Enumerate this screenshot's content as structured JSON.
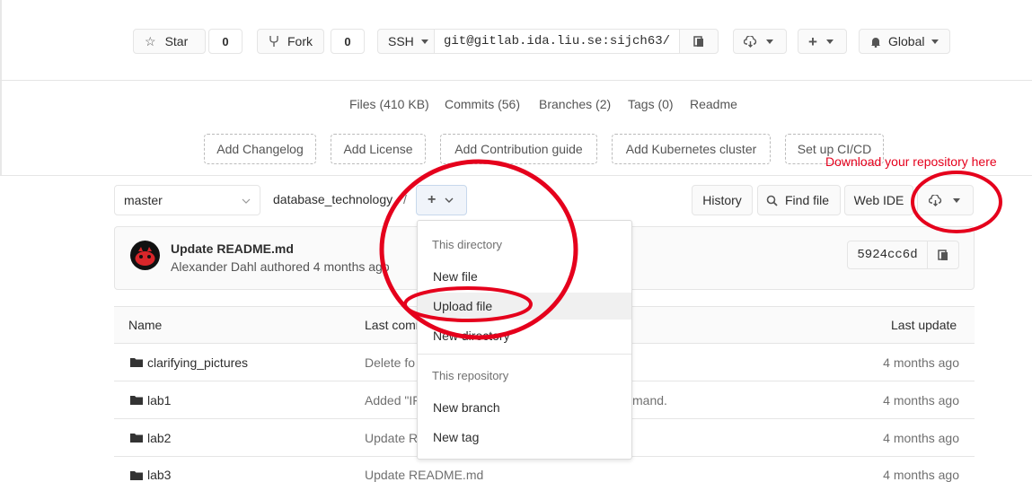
{
  "top_bar": {
    "star_label": "Star",
    "star_count": "0",
    "fork_label": "Fork",
    "fork_count": "0",
    "clone_protocol": "SSH",
    "clone_url": "git@gitlab.ida.liu.se:sijch63/",
    "notification_label": "Global"
  },
  "stats": {
    "files": "Files (410 KB)",
    "commits": "Commits (56)",
    "branches": "Branches (2)",
    "tags": "Tags (0)",
    "readme": "Readme"
  },
  "quick_actions": [
    "Add Changelog",
    "Add License",
    "Add Contribution guide",
    "Add Kubernetes cluster",
    "Set up CI/CD"
  ],
  "annotation": "Download your repository here",
  "toolbar": {
    "branch": "master",
    "path": "database_technology",
    "path_sep": "/",
    "history": "History",
    "find_file": "Find file",
    "web_ide": "Web IDE"
  },
  "last_commit": {
    "title": "Update README.md",
    "meta": "Alexander Dahl authored 4 months ago",
    "sha": "5924cc6d"
  },
  "table": {
    "headers": {
      "name": "Name",
      "last_commit": "Last commit",
      "last_update": "Last update"
    },
    "rows": [
      {
        "name": "clarifying_pictures",
        "message": "Delete fo",
        "date": "4 months ago"
      },
      {
        "name": "lab1",
        "message": "Added \"IF",
        "message_tail": "mand.",
        "date": "4 months ago"
      },
      {
        "name": "lab2",
        "message": "Update R",
        "date": "4 months ago"
      },
      {
        "name": "lab3",
        "message": "Update README.md",
        "date": "4 months ago"
      }
    ]
  },
  "dropdown": {
    "section1": "This directory",
    "items1": [
      "New file",
      "Upload file",
      "New directory"
    ],
    "section2": "This repository",
    "items2": [
      "New branch",
      "New tag"
    ]
  },
  "colors": {
    "annotation_red": "#e5001c",
    "border": "#e5e5e5",
    "hover": "#f0f0f0"
  }
}
